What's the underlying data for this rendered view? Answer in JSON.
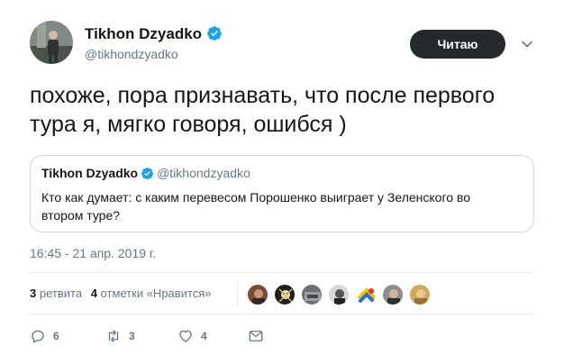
{
  "author": {
    "name": "Tikhon Dzyadko",
    "handle": "@tikhondzyadko",
    "verified": true
  },
  "follow_button": {
    "label": "Читаю"
  },
  "tweet": {
    "text": "похоже, пора признавать, что после первого тура я, мягко говоря, ошибся )"
  },
  "quoted_tweet": {
    "name": "Tikhon Dzyadko",
    "handle": "@tikhondzyadko",
    "text": "Кто как думает: с каким перевесом Порошенко выиграет у Зеленского во втором туре?"
  },
  "timestamp": "16:45 - 21 апр. 2019 г.",
  "stats": {
    "retweets_count": "3",
    "retweets_label": "ретвита",
    "likes_count": "4",
    "likes_label": "отметки «Нравится»"
  },
  "actions": {
    "replies": "6",
    "retweets": "3",
    "likes": "4"
  },
  "colors": {
    "verified": "#1da1f2",
    "button_bg": "#24292e",
    "muted": "#657786"
  },
  "icons": [
    "verified-badge-icon",
    "chevron-down-icon",
    "reply-icon",
    "retweet-icon",
    "heart-icon",
    "message-icon"
  ]
}
